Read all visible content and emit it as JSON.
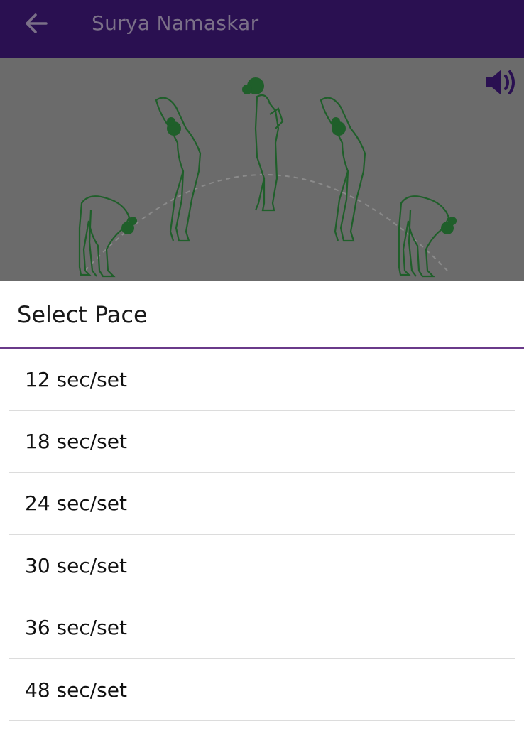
{
  "app": {
    "title": "Surya Namaskar",
    "back_icon": "arrow-left-icon",
    "sound_icon": "speaker-icon",
    "bar_color": "#2a1051"
  },
  "hero": {
    "illustration": "sun-salutation-poses",
    "figure_color": "#1f5f2a"
  },
  "sheet": {
    "title": "Select Pace",
    "accent_color": "#6a3a8a",
    "options": [
      {
        "label": "12 sec/set"
      },
      {
        "label": "18 sec/set"
      },
      {
        "label": "24 sec/set"
      },
      {
        "label": "30 sec/set"
      },
      {
        "label": "36 sec/set"
      },
      {
        "label": "48 sec/set"
      }
    ]
  }
}
